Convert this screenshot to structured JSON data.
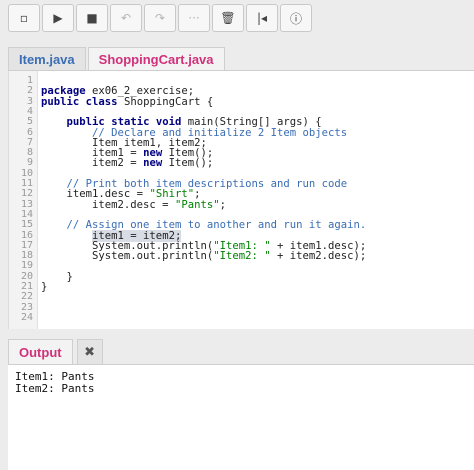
{
  "toolbar": {
    "buttons": [
      {
        "icon": "new-file-icon",
        "glyph": "▫"
      },
      {
        "icon": "run-icon",
        "glyph": "▶"
      },
      {
        "icon": "stop-icon",
        "glyph": "■"
      },
      {
        "icon": "undo-icon",
        "glyph": "↶"
      },
      {
        "icon": "redo-icon",
        "glyph": "↷"
      },
      {
        "icon": "more-icon",
        "glyph": "···"
      },
      {
        "icon": "trash-icon",
        "glyph": "🗑"
      },
      {
        "icon": "step-back-icon",
        "glyph": "|◂"
      },
      {
        "icon": "info-icon",
        "glyph": "ⓘ"
      }
    ]
  },
  "tabs": [
    {
      "label": "Item.java",
      "active": false
    },
    {
      "label": "ShoppingCart.java",
      "active": true
    }
  ],
  "code_lines": [
    {
      "n": "1",
      "text": ""
    },
    {
      "n": "2",
      "text": "package ex06_2_exercise;"
    },
    {
      "n": "3",
      "text": "public class ShoppingCart {"
    },
    {
      "n": "4",
      "text": ""
    },
    {
      "n": "5",
      "text": "    public static void main(String[] args) {"
    },
    {
      "n": "6",
      "text": "        // Declare and initialize 2 Item objects"
    },
    {
      "n": "7",
      "text": "        Item item1, item2;"
    },
    {
      "n": "8",
      "text": "        item1 = new Item();"
    },
    {
      "n": "9",
      "text": "        item2 = new Item();"
    },
    {
      "n": "10",
      "text": ""
    },
    {
      "n": "11",
      "text": "    // Print both item descriptions and run code"
    },
    {
      "n": "12",
      "text": "    item1.desc = \"Shirt\";"
    },
    {
      "n": "13",
      "text": "        item2.desc = \"Pants\";"
    },
    {
      "n": "14",
      "text": ""
    },
    {
      "n": "15",
      "text": "    // Assign one item to another and run it again."
    },
    {
      "n": "16",
      "text": "        item1 = item2;"
    },
    {
      "n": "17",
      "text": "        System.out.println(\"Item1: \" + item1.desc);"
    },
    {
      "n": "18",
      "text": "        System.out.println(\"Item2: \" + item2.desc);"
    },
    {
      "n": "19",
      "text": ""
    },
    {
      "n": "20",
      "text": "    }"
    },
    {
      "n": "21",
      "text": "}"
    },
    {
      "n": "22",
      "text": ""
    },
    {
      "n": "23",
      "text": ""
    },
    {
      "n": "24",
      "text": ""
    }
  ],
  "output_panel": {
    "tab_label": "Output",
    "close_icon": "close-icon",
    "lines": [
      "Item1: Pants",
      "Item2: Pants"
    ]
  },
  "colors": {
    "active_tab": "#d1307a",
    "inactive_tab": "#3a6db5",
    "keyword": "#000080",
    "comment": "#3a6db5",
    "string": "#008000"
  }
}
